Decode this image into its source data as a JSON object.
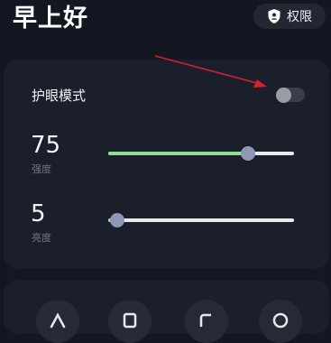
{
  "header": {
    "greeting": "早上好",
    "permission_button": {
      "label": "权限",
      "icon": "shield-icon"
    }
  },
  "eye_care": {
    "label": "护眼模式",
    "enabled": false
  },
  "sliders": [
    {
      "value": "75",
      "label": "强度",
      "level": 0.75,
      "color": "#8ee08f"
    },
    {
      "value": "5",
      "label": "亮度",
      "level": 0.05,
      "color": "#8ee08f"
    }
  ],
  "quick_actions": [
    {
      "icon": "wave-icon"
    },
    {
      "icon": "document-icon"
    },
    {
      "icon": "screen-icon"
    },
    {
      "icon": "timer-icon"
    }
  ],
  "annotation": {
    "color": "#d8202a"
  }
}
